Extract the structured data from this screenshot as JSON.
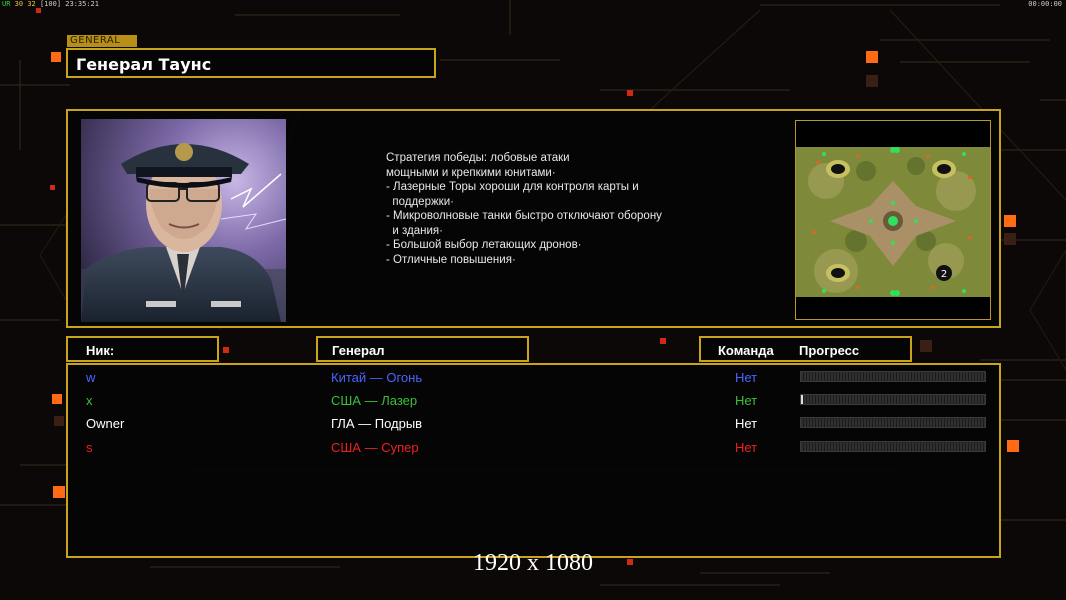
{
  "hud": {
    "stats_ur": "UR",
    "stats_1": "30",
    "stats_2": "32",
    "stats_3": "[100]",
    "clock": "23:35:21",
    "timer_right": "00:00:00"
  },
  "general": {
    "tag": "GENERAL",
    "name": "Генерал Таунс"
  },
  "strategy": {
    "lines": [
      "Стратегия победы: лобовые атаки",
      "мощными и крепкими юнитами·",
      "",
      "- Лазерные Торы хороши для контроля карты и",
      "  поддержки·",
      "- Микроволновые танки быстро отключают оборону",
      "  и здания·",
      "",
      "- Большой выбор летающих дронов·",
      "- Отличные повышения·"
    ]
  },
  "minimap": {
    "player_marker": "2"
  },
  "headers": {
    "nick": "Ник:",
    "general": "Генерал",
    "team": "Команда",
    "progress": "Прогресс"
  },
  "players": [
    {
      "nick": "w",
      "general": "Китай — Огонь",
      "team": "Нет",
      "progress": 0.0,
      "color": "#4a64ff"
    },
    {
      "nick": "x",
      "general": "США — Лазер",
      "team": "Нет",
      "progress": 0.01,
      "color": "#38c238"
    },
    {
      "nick": "Owner",
      "general": "ГЛА — Подрыв",
      "team": "Нет",
      "progress": 0.0,
      "color": "#ffffff"
    },
    {
      "nick": "s",
      "general": "США — Супер",
      "team": "Нет",
      "progress": 0.0,
      "color": "#ee2020"
    }
  ],
  "resolution_label": "1920 x 1080",
  "colors": {
    "accent_gold": "#c9a31a",
    "accent_orange": "#ff6a00"
  }
}
